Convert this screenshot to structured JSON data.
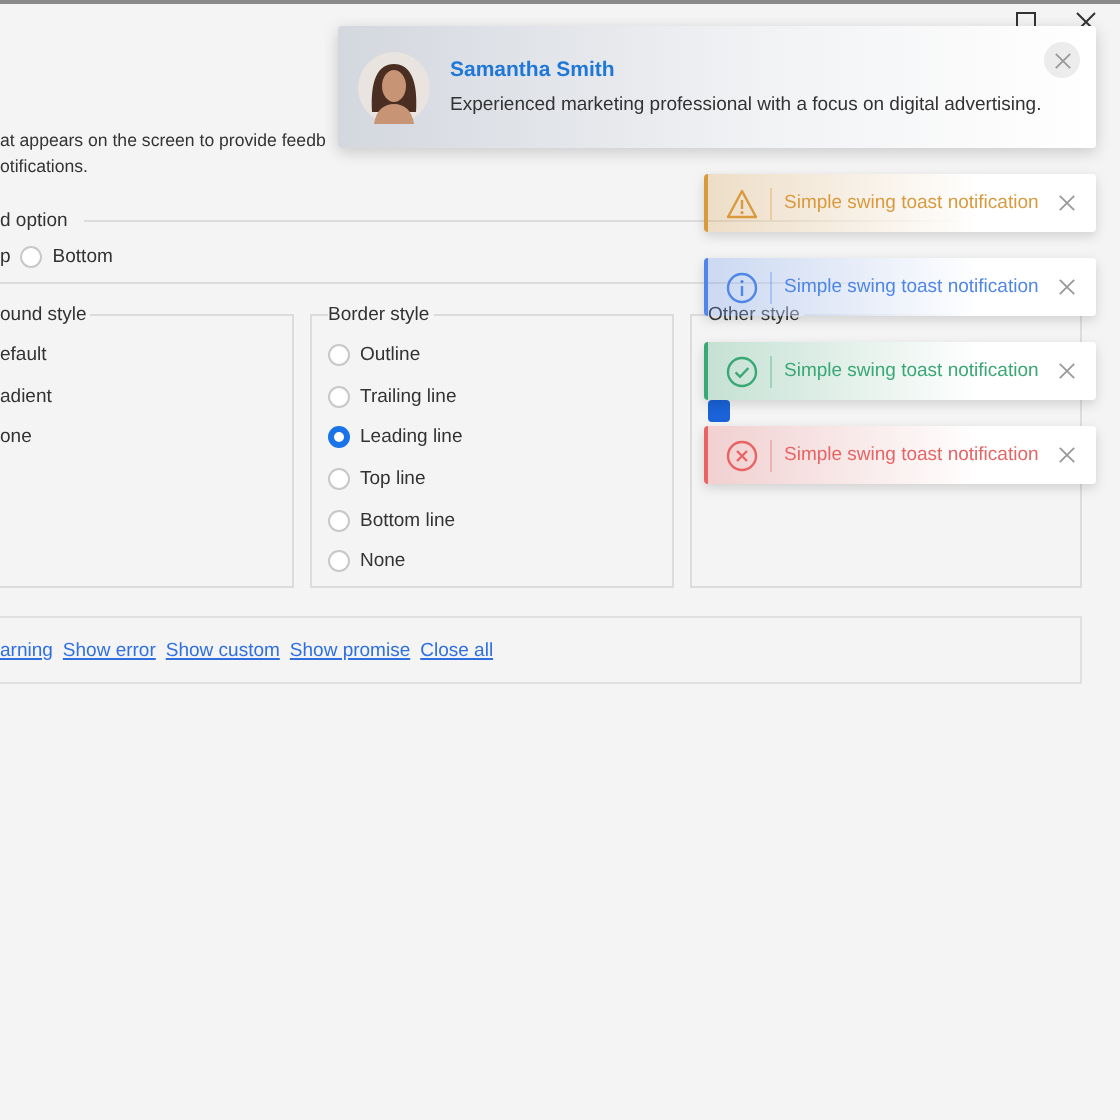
{
  "description": [
    "at appears on the screen to provide feedb",
    "otifications."
  ],
  "position": {
    "label": "d option",
    "cut_option": "p",
    "options": [
      {
        "label": "Bottom",
        "selected": false
      }
    ]
  },
  "background_style": {
    "title": "ound style",
    "items": [
      "efault",
      "adient",
      "one"
    ]
  },
  "border_style": {
    "title": "Border style",
    "options": [
      {
        "label": "Outline",
        "selected": false
      },
      {
        "label": "Trailing line",
        "selected": false
      },
      {
        "label": "Leading line",
        "selected": true
      },
      {
        "label": "Top line",
        "selected": false
      },
      {
        "label": "Bottom line",
        "selected": false
      },
      {
        "label": "None",
        "selected": false
      }
    ]
  },
  "other_style": {
    "title": "Other style",
    "checkbox": {
      "checked": true
    }
  },
  "links": [
    "arning",
    "Show error",
    "Show custom",
    "Show promise",
    "Close all"
  ],
  "profile_toast": {
    "name": "Samantha Smith",
    "message": "Experienced marketing professional with a focus on digital advertising."
  },
  "toasts": [
    {
      "kind": "warning",
      "text": "Simple swing toast notification",
      "color": "#d99a3e"
    },
    {
      "kind": "info",
      "text": "Simple swing toast notification",
      "color": "#4f86e8"
    },
    {
      "kind": "success",
      "text": "Simple swing toast notification",
      "color": "#3aa874"
    },
    {
      "kind": "error",
      "text": "Simple swing toast notification",
      "color": "#e86464"
    }
  ]
}
